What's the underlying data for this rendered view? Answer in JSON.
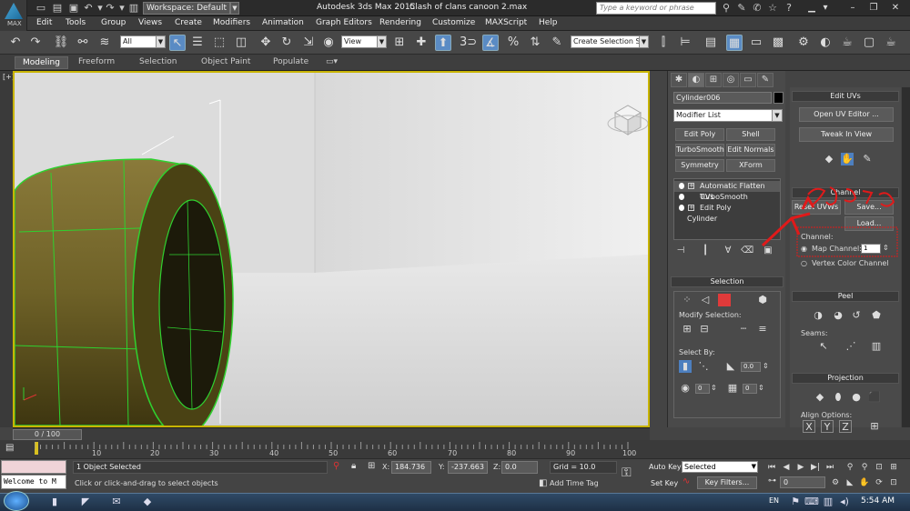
{
  "titlebar": {
    "logo_text": "MAX",
    "workspace": "Workspace: Default",
    "app_title": "Autodesk 3ds Max  2015",
    "file_title": "Clash of clans canoon 2.max",
    "search_placeholder": "Type a keyword or phrase"
  },
  "menu": [
    "Edit",
    "Tools",
    "Group",
    "Views",
    "Create",
    "Modifiers",
    "Animation",
    "Graph Editors",
    "Rendering",
    "Customize",
    "MAXScript",
    "Help"
  ],
  "toolbar": {
    "selection_filter": "All",
    "ref_coord": "View",
    "snap_label": "3",
    "named_selection": "Create Selection Se"
  },
  "ribbon": {
    "tabs": [
      "Modeling",
      "Freeform",
      "Selection",
      "Object Paint",
      "Populate"
    ]
  },
  "viewport": {
    "label": "[+]"
  },
  "cmdpanel": {
    "object_name": "Cylinder006",
    "modifier_list": "Modifier List",
    "buttons": [
      "Edit Poly",
      "Shell",
      "TurboSmooth",
      "Edit Normals",
      "Symmetry",
      "XForm"
    ],
    "stack": [
      "Automatic Flatten UVs",
      "TurboSmooth",
      "Edit Poly",
      "Cylinder"
    ],
    "selection_title": "Selection",
    "modify_selection": "Modify Selection:",
    "select_by": "Select By:",
    "spin_value": "0.0",
    "spin_a": "0",
    "spin_b": "0"
  },
  "rpanel": {
    "edit_uvs_title": "Edit UVs",
    "open_uv_editor": "Open UV Editor ...",
    "tweak_in_view": "Tweak In View",
    "channel_title": "Channel",
    "reset_uvws": "Reset UVWs",
    "save": "Save...",
    "load": "Load...",
    "channel_label": "Channel:",
    "map_channel": "Map Channel:",
    "map_channel_value": "1",
    "vertex_color_channel": "Vertex Color Channel",
    "peel_title": "Peel",
    "seams": "Seams:",
    "projection_title": "Projection",
    "align_options": "Align Options:",
    "align_x": "X",
    "align_y": "Y",
    "align_z": "Z"
  },
  "timeline": {
    "slider": "0 / 100",
    "ticks": [
      "10",
      "20",
      "30",
      "40",
      "50",
      "60",
      "70",
      "80",
      "90",
      "100"
    ]
  },
  "status": {
    "maxscript_output": "Welcome to M",
    "objects_selected": "1 Object Selected",
    "prompt": "Click or click-and-drag to select objects",
    "x_label": "X:",
    "x_value": "184.736",
    "y_label": "Y:",
    "y_value": "-237.663",
    "z_label": "Z:",
    "z_value": "0.0",
    "grid": "Grid = 10.0",
    "add_time_tag": "Add Time Tag",
    "auto_key": "Auto Key",
    "set_key": "Set Key",
    "key_mode": "Selected",
    "key_filters": "Key Filters...",
    "frame": "0"
  },
  "taskbar": {
    "lang": "EN",
    "clock": "5:54 AM"
  },
  "colors": {
    "viewport_border": "#c8b400",
    "selection_wire": "#2fd12f",
    "annotation_red": "#e01a1a",
    "active_blue": "#5a8bc4"
  }
}
